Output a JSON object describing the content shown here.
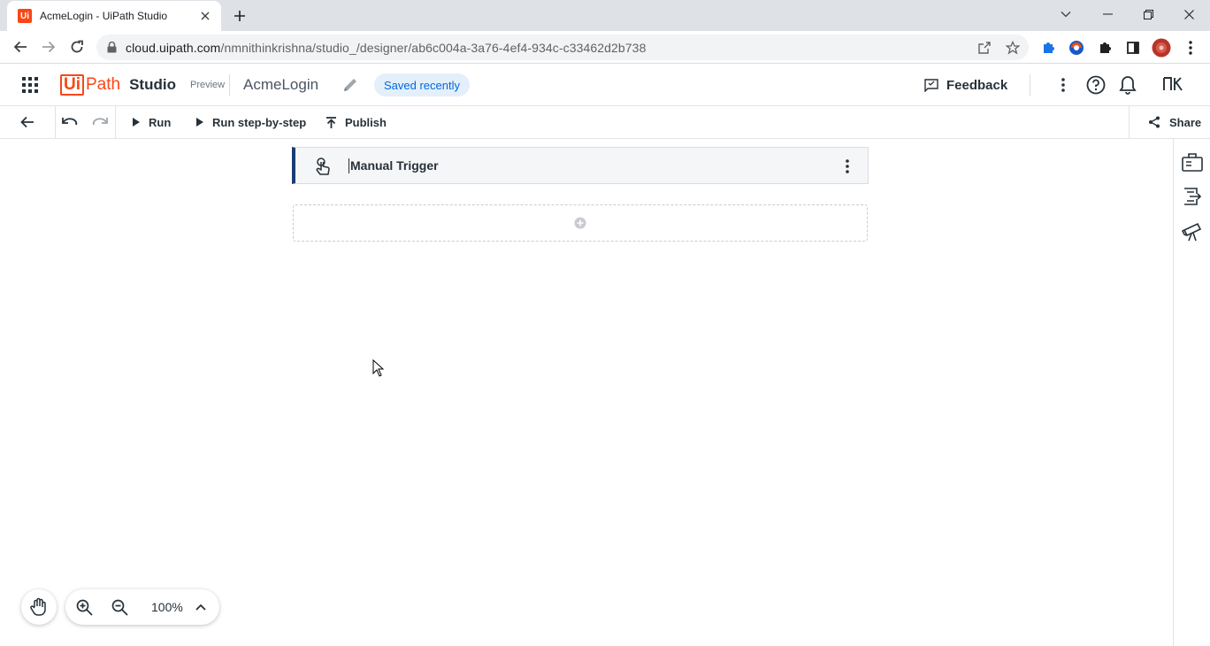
{
  "browser": {
    "tab_title": "AcmeLogin - UiPath Studio",
    "favicon_text": "Ui",
    "url_host": "cloud.uipath.com",
    "url_path": "/nmnithinkrishna/studio_/designer/ab6c004a-3a76-4ef4-934c-c33462d2b738"
  },
  "header": {
    "brand_ui": "Ui",
    "brand_path": "Path",
    "brand_product": "Studio",
    "brand_badge": "Preview",
    "project_name": "AcmeLogin",
    "save_status": "Saved recently",
    "feedback_label": "Feedback",
    "user_initials": "NK"
  },
  "toolbar": {
    "run_label": "Run",
    "run_step_label": "Run step-by-step",
    "publish_label": "Publish",
    "share_label": "Share"
  },
  "canvas": {
    "trigger_label": "Manual Trigger"
  },
  "zoom": {
    "level": "100%"
  },
  "colors": {
    "brand": "#fa4616",
    "accent": "#0067df",
    "trigger_border": "#1a3c72"
  }
}
